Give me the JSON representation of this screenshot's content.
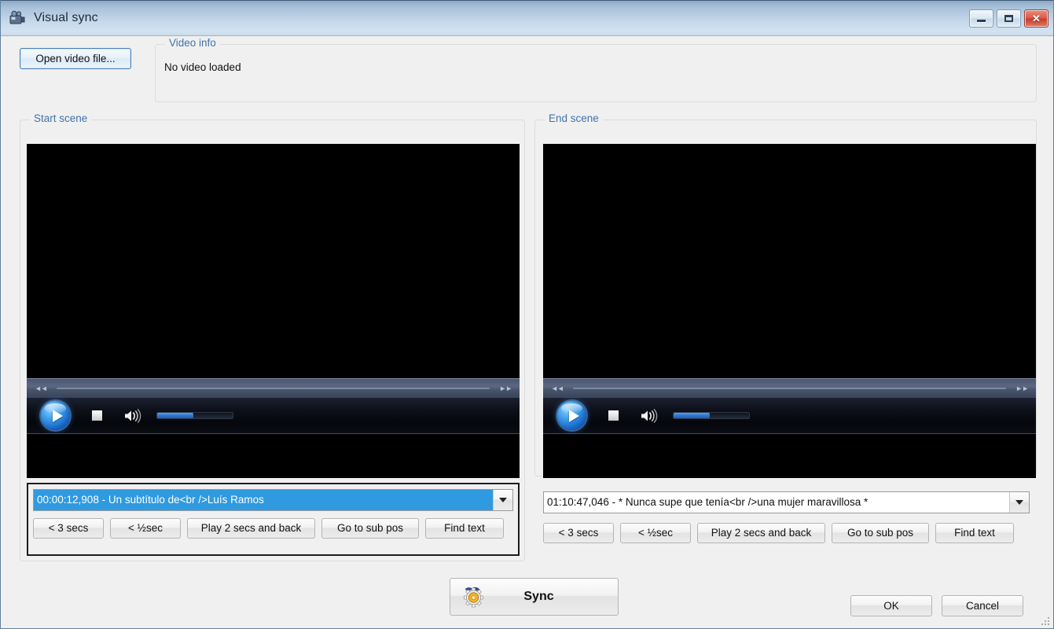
{
  "window": {
    "title": "Visual sync",
    "icon": "film-camera-icon",
    "controls": {
      "minimize": "minimize-icon",
      "maximize": "maximize-icon",
      "close": "✕"
    }
  },
  "toolbar": {
    "open_video_label": "Open video file..."
  },
  "video_info": {
    "title": "Video info",
    "status": "No video loaded"
  },
  "start_scene": {
    "title": "Start scene",
    "player": {
      "play": "play-icon",
      "stop": "stop-icon",
      "volume": "volume-icon",
      "rewind": "◄◄",
      "forward": "►►",
      "volume_percent": 48
    },
    "subtitle_combo": {
      "value": "00:00:12,908 - Un subtítulo de<br />Luís Ramos",
      "selected": true
    },
    "buttons": [
      "< 3 secs",
      "< ½sec",
      "Play 2 secs and back",
      "Go to sub pos",
      "Find text"
    ]
  },
  "end_scene": {
    "title": "End scene",
    "player": {
      "play": "play-icon",
      "stop": "stop-icon",
      "volume": "volume-icon",
      "rewind": "◄◄",
      "forward": "►►",
      "volume_percent": 48
    },
    "subtitle_combo": {
      "value": "01:10:47,046 - * Nunca supe que tenía<br />una mujer maravillosa *",
      "selected": false
    },
    "buttons": [
      "< 3 secs",
      "< ½sec",
      "Play 2 secs and back",
      "Go to sub pos",
      "Find text"
    ]
  },
  "footer": {
    "sync_label": "Sync",
    "sync_icon": "gear-icon",
    "ok_label": "OK",
    "cancel_label": "Cancel"
  },
  "colors": {
    "accent": "#3f73ad",
    "selection": "#2f9ae0",
    "window_bg": "#f0f0f0",
    "titlebar": "#b9cfe4",
    "close_button": "#c43c2c"
  }
}
